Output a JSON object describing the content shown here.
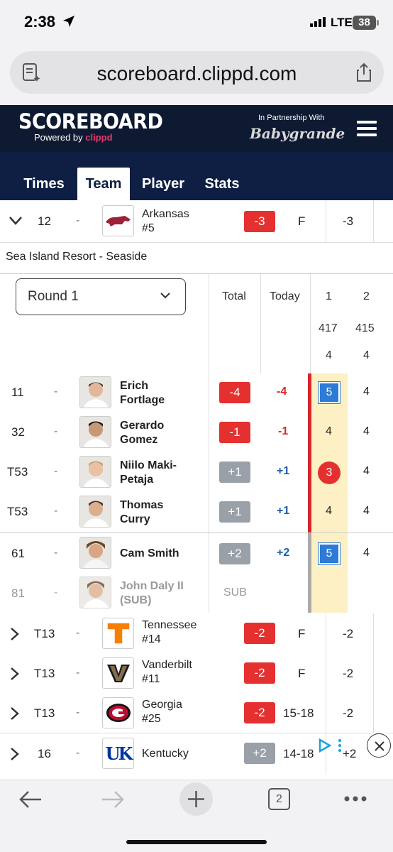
{
  "status": {
    "time": "2:38",
    "network": "LTE",
    "battery": "38"
  },
  "browser": {
    "url": "scoreboard.clippd.com",
    "tab_count": "2"
  },
  "site": {
    "logo": "SCOREBOARD",
    "powered_prefix": "Powered by",
    "powered_brand": "clippd",
    "partner_text": "In Partnership With",
    "partner_brand": "Babygrande"
  },
  "tabs": [
    {
      "label": "Times"
    },
    {
      "label": "Team",
      "active": true
    },
    {
      "label": "Player"
    },
    {
      "label": "Stats"
    }
  ],
  "expanded_team": {
    "pos": "12",
    "dash": "-",
    "name": "Arkansas",
    "rank": "#5",
    "score": "-3",
    "thru": "F",
    "round": "-3",
    "logo_color": "#9d2235"
  },
  "course": "Sea Island Resort - Seaside",
  "scorecard_header": {
    "round_select": "Round 1",
    "total": "Total",
    "today": "Today",
    "holes": [
      {
        "num": "1",
        "yards": "417",
        "par": "4"
      },
      {
        "num": "2",
        "yards": "415",
        "par": "4"
      }
    ]
  },
  "players": [
    {
      "pos": "11",
      "dash": "-",
      "first": "Erich",
      "last": "Fortlage",
      "total": "-4",
      "today": "-4",
      "h1": "5",
      "h2": "4",
      "h1_mark": "square"
    },
    {
      "pos": "32",
      "dash": "-",
      "first": "Gerardo",
      "last": "Gomez",
      "total": "-1",
      "today": "-1",
      "h1": "4",
      "h2": "4",
      "h1_mark": "none"
    },
    {
      "pos": "T53",
      "dash": "-",
      "first": "Niilo Maki-",
      "last": "Petaja",
      "total": "+1",
      "today": "+1",
      "h1": "3",
      "h2": "4",
      "h1_mark": "circle"
    },
    {
      "pos": "T53",
      "dash": "-",
      "first": "Thomas",
      "last": "Curry",
      "total": "+1",
      "today": "+1",
      "h1": "4",
      "h2": "4",
      "h1_mark": "none"
    },
    {
      "pos": "61",
      "dash": "-",
      "first": "Cam Smith",
      "last": "",
      "total": "+2",
      "today": "+2",
      "h1": "5",
      "h2": "4",
      "h1_mark": "square"
    },
    {
      "pos": "81",
      "dash": "-",
      "first": "John Daly II",
      "last": "(SUB)",
      "total": "SUB",
      "today": "",
      "h1": "",
      "h2": "",
      "h1_mark": "none"
    }
  ],
  "other_teams": [
    {
      "pos": "T13",
      "dash": "-",
      "name": "Tennessee",
      "rank": "#14",
      "score": "-2",
      "thru": "F",
      "round": "-2",
      "logo_letter": "T",
      "logo_color": "#f77f00"
    },
    {
      "pos": "T13",
      "dash": "-",
      "name": "Vanderbilt",
      "rank": "#11",
      "score": "-2",
      "thru": "F",
      "round": "-2",
      "logo_letter": "V",
      "logo_color": "#866d4b"
    },
    {
      "pos": "T13",
      "dash": "-",
      "name": "Georgia",
      "rank": "#25",
      "score": "-2",
      "thru": "15-18",
      "round": "-2",
      "logo_letter": "G",
      "logo_color": "#ba0c2f"
    },
    {
      "pos": "16",
      "dash": "-",
      "name": "Kentucky",
      "rank": "",
      "score": "+2",
      "thru": "14-18",
      "round": "+2",
      "logo_letter": "UK",
      "logo_color": "#0033a0"
    }
  ]
}
